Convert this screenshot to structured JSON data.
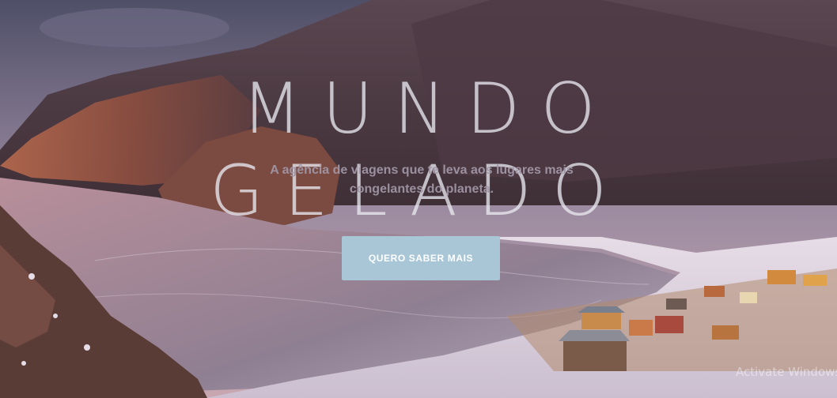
{
  "hero": {
    "title": "MUNDO GELADO",
    "subtitle": "A agência de viagens que te leva aos lugares mais congelantes do planeta.",
    "cta_label": "QUERO SABER MAIS",
    "background_image": "winter-lake-mountain-village-photo"
  },
  "system": {
    "activation_watermark": "Activate Windows"
  },
  "colors": {
    "button_bg": "#a9c6d6",
    "button_text": "#ffffff",
    "title_text": "#e8e8f0"
  }
}
